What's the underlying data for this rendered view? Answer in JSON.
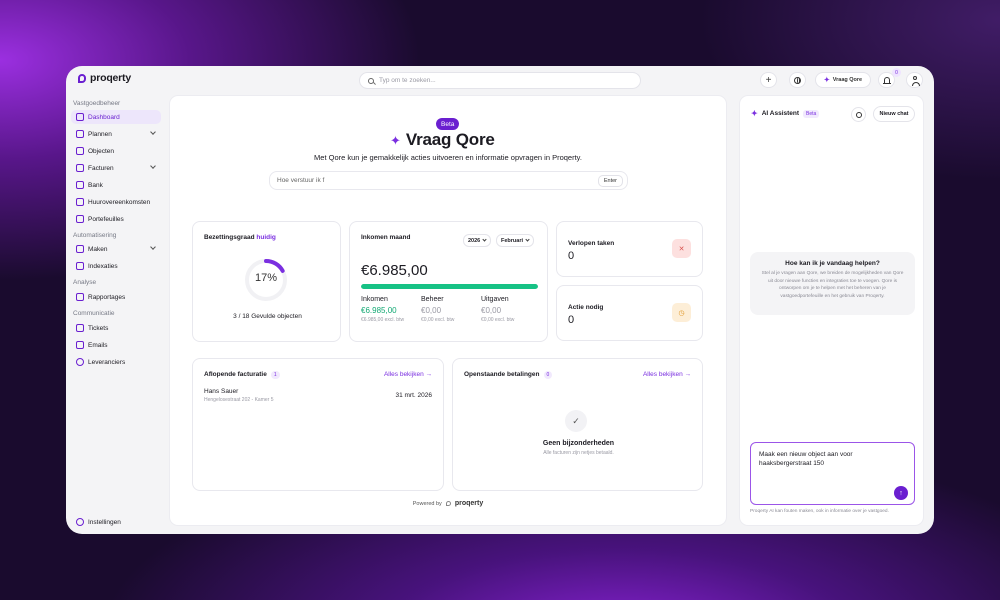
{
  "app": {
    "logo_text": "proqerty"
  },
  "topbar": {
    "search_placeholder": "Typ om te zoeken...",
    "plus_label": "+",
    "ask_qore_label": "Vraag Qore",
    "notifications_count": "0"
  },
  "sidebar": {
    "section_vastgoed": "Vastgoedbeheer",
    "dashboard": "Dashboard",
    "plannen": "Plannen",
    "objecten": "Objecten",
    "facturen": "Facturen",
    "bank": "Bank",
    "huurovereenkomsten": "Huurovereenkomsten",
    "portefeuilles": "Portefeuilles",
    "section_automatisering": "Automatisering",
    "maken": "Maken",
    "indexaties": "Indexaties",
    "section_analyse": "Analyse",
    "rapportages": "Rapportages",
    "section_communicatie": "Communicatie",
    "tickets": "Tickets",
    "emails": "Emails",
    "leveranciers": "Leveranciers",
    "instellingen": "Instellingen"
  },
  "hero": {
    "badge": "Beta",
    "title": "Vraag Qore",
    "subtitle": "Met Qore kun je gemakkelijk acties uitvoeren en informatie opvragen in Proqerty.",
    "input_value": "Hoe verstuur ik f",
    "enter_label": "Enter"
  },
  "bezetting": {
    "title": "Bezettingsgraad",
    "title_accent": "huidig",
    "percent_label": "17%",
    "percent_value": 17,
    "subtitle": "3 / 18 Gevulde objecten"
  },
  "inkomen": {
    "title": "Inkomen maand",
    "year": "2026",
    "month": "Februari",
    "amount": "€6.985,00",
    "progress": 1.0,
    "cols": [
      {
        "label": "Inkomen",
        "value": "€6.985,00",
        "ex": "€6.985,00 excl. btw"
      },
      {
        "label": "Beheer",
        "value": "€0,00",
        "ex": "€0,00 excl. btw"
      },
      {
        "label": "Uitgaven",
        "value": "€0,00",
        "ex": "€0,00 excl. btw"
      }
    ]
  },
  "verlopen": {
    "title": "Verlopen taken",
    "count": "0"
  },
  "actie": {
    "title": "Actie nodig",
    "count": "0"
  },
  "facturatie": {
    "title": "Aflopende facturatie",
    "count": "1",
    "see_all": "Alles bekijken →",
    "row": {
      "name": "Hans Sauer",
      "address": "Hengelosestraat 202 - Kamer 5",
      "date": "31 mrt. 2026"
    }
  },
  "betalingen": {
    "title": "Openstaande betalingen",
    "count": "0",
    "see_all": "Alles bekijken →",
    "empty_title": "Geen bijzonderheden",
    "empty_sub": "Alle facturen zijn netjes betaald."
  },
  "powered": {
    "label": "Powered by",
    "brand": "proqerty"
  },
  "ai": {
    "title": "AI Assistent",
    "beta": "Beta",
    "new_chat": "Nieuw chat",
    "help_title": "Hoe kan ik je vandaag helpen?",
    "help_text": "Stel al je vragen aan Qore, we breiden de mogelijkheden van Qore uit door nieuwe functies en integraties toe te voegen. Qore is ontworpen om je te helpen met het beheren van je vastgoedportefeuille en het gebruik van Proqerty.",
    "prompt_value": "Maak een nieuw object aan voor haaksbergerstraat 150",
    "send": "↑",
    "disclaimer": "Proqerty AI kan fouten maken, ook in informatie over je vastgoed."
  },
  "colors": {
    "accent": "#6a1fd0",
    "success": "#16c285"
  }
}
